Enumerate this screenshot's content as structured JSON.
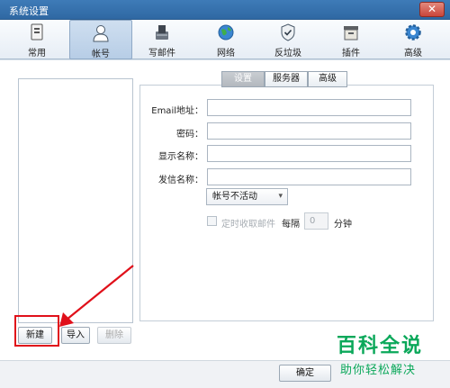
{
  "window": {
    "title": "系统设置",
    "close_glyph": "✕"
  },
  "toolbar": {
    "items": [
      {
        "label": "常用",
        "icon": "common-icon"
      },
      {
        "label": "帐号",
        "icon": "account-icon",
        "active": true
      },
      {
        "label": "写邮件",
        "icon": "compose-icon"
      },
      {
        "label": "网络",
        "icon": "network-icon"
      },
      {
        "label": "反垃圾",
        "icon": "antispam-icon"
      },
      {
        "label": "插件",
        "icon": "plugin-icon"
      },
      {
        "label": "高级",
        "icon": "advanced-icon"
      }
    ]
  },
  "tabs": [
    {
      "label": "设置",
      "active": true
    },
    {
      "label": "服务器",
      "active": false
    },
    {
      "label": "高级",
      "active": false
    }
  ],
  "form": {
    "email_label": "Email地址：",
    "password_label": "密码：",
    "display_name_label": "显示名称：",
    "sender_name_label": "发信名称：",
    "email_value": "",
    "password_value": "",
    "display_name_value": "",
    "sender_name_value": "",
    "status_select": "帐号不活动",
    "auto_check_label": "定时收取邮件",
    "interval_label": "每隔",
    "interval_value": "0",
    "interval_unit": "分钟"
  },
  "buttons": {
    "new": "新建",
    "import": "导入",
    "delete": "删除",
    "ok": "确定"
  },
  "watermark": {
    "title": "百科全说",
    "subtitle": "助你轻松解决"
  },
  "colors": {
    "titlebar": "#3e7bb8",
    "highlight_box": "#e0101a",
    "arrow": "#e0101a",
    "watermark": "#0ba85a"
  }
}
